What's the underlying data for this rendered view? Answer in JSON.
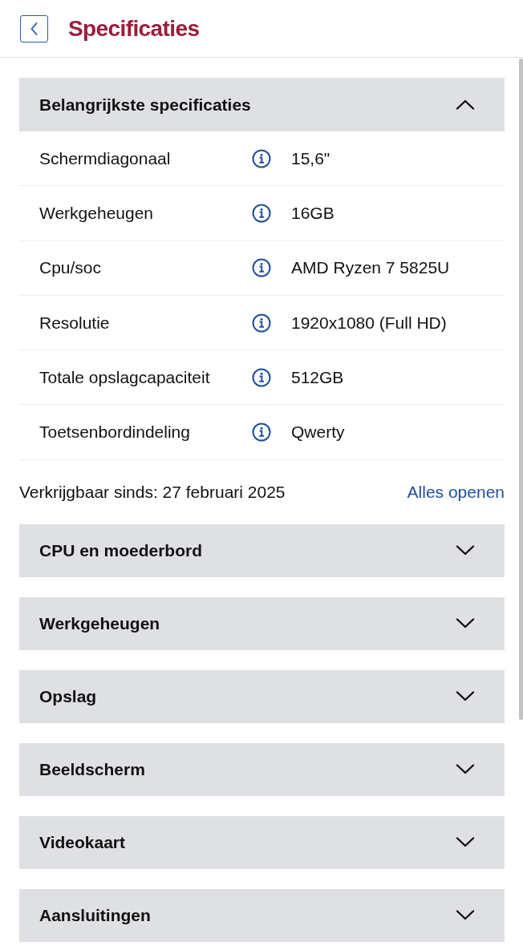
{
  "header": {
    "title": "Specificaties"
  },
  "main_section": {
    "title": "Belangrijkste specificaties",
    "expanded": true,
    "rows": [
      {
        "label": "Schermdiagonaal",
        "value": "15,6\""
      },
      {
        "label": "Werkgeheugen",
        "value": "16GB"
      },
      {
        "label": "Cpu/soc",
        "value": "AMD Ryzen 7 5825U"
      },
      {
        "label": "Resolutie",
        "value": "1920x1080 (Full HD)"
      },
      {
        "label": "Totale opslagcapaciteit",
        "value": "512GB"
      },
      {
        "label": "Toetsenbordindeling",
        "value": "Qwerty"
      }
    ]
  },
  "availability": {
    "text": "Verkrijgbaar sinds: 27 februari 2025",
    "link": "Alles openen"
  },
  "sections": [
    {
      "title": "CPU en moederbord",
      "expanded": false
    },
    {
      "title": "Werkgeheugen",
      "expanded": false
    },
    {
      "title": "Opslag",
      "expanded": false
    },
    {
      "title": "Beeldscherm",
      "expanded": false
    },
    {
      "title": "Videokaart",
      "expanded": false
    },
    {
      "title": "Aansluitingen",
      "expanded": false
    }
  ]
}
